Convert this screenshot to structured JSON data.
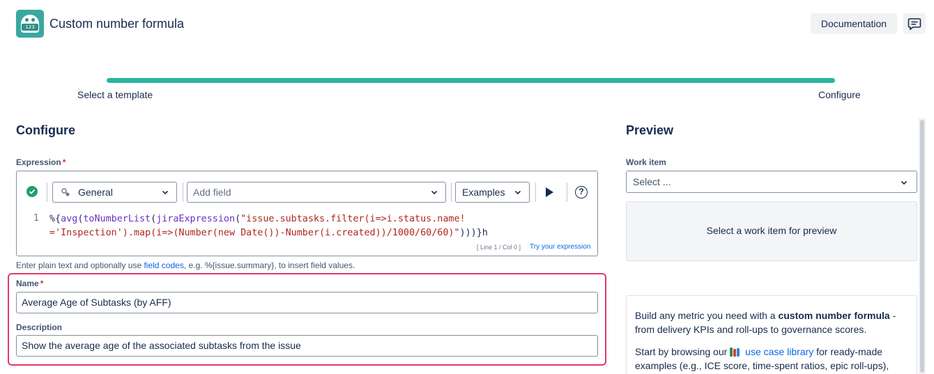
{
  "header": {
    "title": "Custom number formula",
    "logo_text": "123",
    "documentation_label": "Documentation"
  },
  "stepper": {
    "steps": [
      "Select a template",
      "Configure"
    ],
    "progress": 1.0
  },
  "configure": {
    "title": "Configure",
    "expression_label": "Expression",
    "required_mark": "*",
    "toolbar": {
      "status_icon": "check-circle-icon",
      "type_value": "General",
      "add_field_placeholder": "Add field",
      "examples_label": "Examples",
      "run_icon": "play-icon",
      "help_icon": "?"
    },
    "code": {
      "line_number": "1",
      "cursor_info": "[ Line 1 / Col 0 ]",
      "try_link": "Try your expression"
    },
    "helper": {
      "before": "Enter plain text and optionally use ",
      "link": "field codes",
      "after": ", e.g. %{issue.summary}, to insert field values."
    },
    "name_label": "Name",
    "name_value": "Average Age of Subtasks (by AFF)",
    "description_label": "Description",
    "description_value": "Show the average age of the associated subtasks from the issue"
  },
  "preview": {
    "title": "Preview",
    "work_item_label": "Work item",
    "select_placeholder": "Select ...",
    "empty_text": "Select a work item for preview",
    "info": {
      "p1_before": "Build any metric you need with a ",
      "p1_bold": "custom number formula",
      "p1_after": " - from delivery KPIs and roll-ups to governance scores.",
      "p2_before": "Start by browsing our ",
      "p2_link": "use case library",
      "p2_after": " for ready-made examples (e.g., ICE score, time-spent ratios, epic roll-ups),"
    }
  },
  "colors": {
    "accent_teal": "#2bb3a3",
    "highlight_pink": "#e3386c",
    "link_blue": "#0c66e4",
    "success_green": "#22a06b"
  }
}
